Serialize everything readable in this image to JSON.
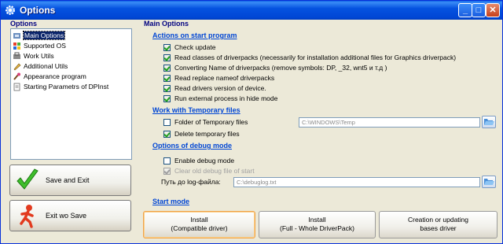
{
  "window": {
    "title": "Options",
    "controls": [
      "minimize-icon",
      "maximize-icon",
      "close-icon"
    ]
  },
  "left": {
    "section_title": "Options",
    "tree": [
      {
        "label": "Main Options",
        "selected": true,
        "icon": "config-icon"
      },
      {
        "label": "Supported OS",
        "selected": false,
        "icon": "windows-icon"
      },
      {
        "label": "Work Utils",
        "selected": false,
        "icon": "tools-icon"
      },
      {
        "label": "Additional Utils",
        "selected": false,
        "icon": "pencil-icon"
      },
      {
        "label": "Appearance program",
        "selected": false,
        "icon": "brush-icon"
      },
      {
        "label": "Starting Parametrs of DPInst",
        "selected": false,
        "icon": "page-icon"
      }
    ],
    "save_exit_label": "Save and Exit",
    "exit_no_save_label": "Exit wo Save"
  },
  "main": {
    "section_title": "Main Options",
    "actions": {
      "title": "Actions on start program",
      "items": [
        {
          "label": "Check update",
          "checked": true
        },
        {
          "label": "Read classes of driverpacks (necessarily for installation additional files for Graphics driverpack)",
          "checked": true
        },
        {
          "label": "Converting Name of driverpacks (remove symbols: DP, _32, wnt5 и т.д )",
          "checked": true
        },
        {
          "label": "Read replace nameof driverpacks",
          "checked": true
        },
        {
          "label": "Read drivers version of device.",
          "checked": true
        },
        {
          "label": "Run external process in hide mode",
          "checked": true
        }
      ]
    },
    "temp": {
      "title": "Work with Temporary files",
      "folder_label": "Folder of Temporary files",
      "folder_checked": false,
      "folder_path": "C:\\WINDOWS\\Temp",
      "delete_label": "Delete temporary files",
      "delete_checked": true
    },
    "debug": {
      "title": "Options of debug mode",
      "enable_label": "Enable debug mode",
      "enable_checked": false,
      "clear_label": "Clear old debug file of start",
      "clear_checked": true,
      "log_label": "Путь до log-файла:",
      "log_path": "C:\\debuglog.txt"
    },
    "start_mode": {
      "title": "Start mode",
      "buttons": [
        {
          "line1": "Install",
          "line2": "(Compatible driver)",
          "active": true
        },
        {
          "line1": "Install",
          "line2": "(Full - Whole DriverPack)",
          "active": false
        },
        {
          "line1": "Creation or updating",
          "line2": "bases driver",
          "active": false
        }
      ]
    }
  },
  "colors": {
    "titlebar": "#0054e3",
    "group_title": "#0046d5",
    "section_title": "#000080",
    "face": "#ece9d8"
  }
}
